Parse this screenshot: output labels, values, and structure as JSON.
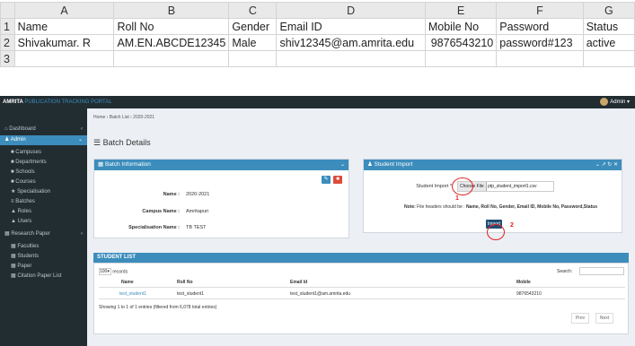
{
  "sheet": {
    "columns": [
      "A",
      "B",
      "C",
      "D",
      "E",
      "F",
      "G"
    ],
    "row_numbers": [
      "1",
      "2",
      "3"
    ],
    "headers": [
      "Name",
      "Roll No",
      "Gender",
      "Email ID",
      "Mobile No",
      "Password",
      "Status"
    ],
    "row2": [
      "Shivakumar. R",
      "AM.EN.ABCDE12345",
      "Male",
      "shiv12345@am.amrita.edu",
      "9876543210",
      "password#123",
      "active"
    ]
  },
  "app": {
    "brand_a": "AMRITA",
    "brand_b": "PUBLICATION TRACKING PORTAL",
    "admin_label": "Admin",
    "sidebar": [
      {
        "label": "Dashboard",
        "icon": "home-icon"
      },
      {
        "label": "Admin",
        "icon": "user-icon"
      },
      {
        "label": "Campuses"
      },
      {
        "label": "Departments"
      },
      {
        "label": "Schools"
      },
      {
        "label": "Courses"
      },
      {
        "label": "Specialisation"
      },
      {
        "label": "Batches"
      },
      {
        "label": "Roles"
      },
      {
        "label": "Users"
      },
      {
        "label": "Research Paper"
      },
      {
        "label": "Faculties"
      },
      {
        "label": "Students"
      },
      {
        "label": "Paper"
      },
      {
        "label": "Citation Paper List"
      }
    ],
    "breadcrumb": "Home  ›  Batch List  ›  2020-2021",
    "page_title": "Batch Details",
    "batch_info": {
      "title": "Batch Information",
      "name_label": "Name :",
      "name_value": "2020-2021",
      "campus_label": "Campus Name :",
      "campus_value": "Amritapuri",
      "spec_label": "Specialisation Name :",
      "spec_value": "TB TEST"
    },
    "student_import": {
      "title": "Student Import",
      "field_label": "Student Import *",
      "choose_file": "Choose File",
      "file_name": "ptp_student_import1.csv",
      "note_bold": "Note:",
      "note_text": " File headers should be : ",
      "note_headers": "Name, Roll No, Gender, Email ID, Mobile No, Password,Status",
      "import_label": "Import",
      "step1": "1",
      "step2": "2"
    },
    "student_list": {
      "title": "STUDENT LIST",
      "page_size": "100",
      "records_label": "records",
      "search_label": "Search:",
      "columns": [
        "Name",
        "Roll No",
        "Email Id",
        "Mobile"
      ],
      "row": [
        "test_student1",
        "test_student1",
        "test_student1@am.amrita.edu",
        "9876543210"
      ],
      "summary": "Showing 1 to 1 of 1 entries (filtered from 6,078 total entries)",
      "prev": "Prev",
      "next": "Next"
    }
  }
}
